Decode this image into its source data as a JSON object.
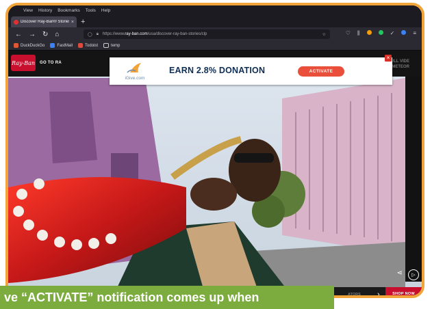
{
  "browser": {
    "menu_items": [
      "View",
      "History",
      "Bookmarks",
      "Tools",
      "Help"
    ],
    "tab_title": "Discover Ray-Ban® Stories Fac",
    "tab_close": "×",
    "new_tab": "+",
    "url_prefix": "https://www.",
    "url_domain": "ray-ban.com",
    "url_path": "/usa/discover-ray-ban-stories/clp",
    "bookmarks": [
      {
        "label": "DuckDuckGo",
        "color": "#de5833"
      },
      {
        "label": "FastMail",
        "color": "#3b82f6"
      },
      {
        "label": "Todoist",
        "color": "#db4c3f"
      },
      {
        "label": "temp",
        "color": "#888888"
      }
    ]
  },
  "site": {
    "logo_text": "Ray-Ban",
    "goto_label": "GO TO RA",
    "right_top_line1": "WATCH FULL VIDE",
    "right_top_line2": "ND   METEOR",
    "bottom_label": "ATORS",
    "shop_now": "SHOP NOW"
  },
  "banner": {
    "logo_text": "iGive.com",
    "title": "EARN 2.8% DONATION",
    "activate_label": "ACTIVATE",
    "close_label": "×",
    "accent_color": "#e94f3a"
  },
  "caption": {
    "text": "ve “ACTIVATE” notification comes up when"
  }
}
